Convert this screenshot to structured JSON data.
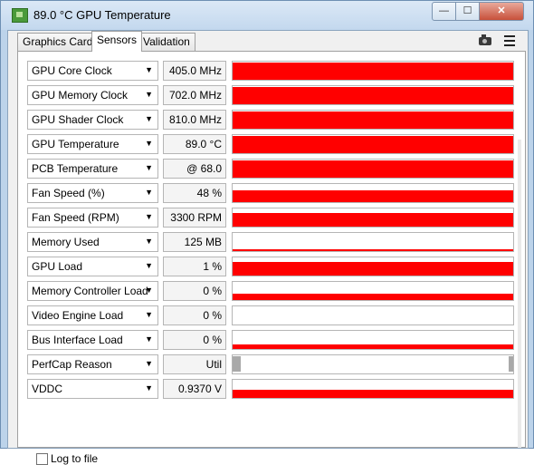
{
  "window": {
    "title": "89.0 °C GPU Temperature",
    "buttons": {
      "minimize": "—",
      "maximize": "☐",
      "close": "✕"
    }
  },
  "tabs": [
    {
      "label": "Graphics Card"
    },
    {
      "label": "Sensors",
      "active": true
    },
    {
      "label": "Validation"
    }
  ],
  "toolbar": {
    "screenshot_icon": "camera-icon",
    "menu_icon": "hamburger-menu-icon"
  },
  "sensors": [
    {
      "name": "GPU Core Clock",
      "value": "405.0 MHz",
      "graph_fill": 0.95
    },
    {
      "name": "GPU Memory Clock",
      "value": "702.0 MHz",
      "graph_fill": 0.95
    },
    {
      "name": "GPU Shader Clock",
      "value": "810.0 MHz",
      "graph_fill": 0.95
    },
    {
      "name": "GPU Temperature",
      "value": "89.0 °C",
      "graph_fill": 0.95
    },
    {
      "name": "PCB Temperature",
      "value": "@ 68.0",
      "graph_fill": 0.95
    },
    {
      "name": "Fan Speed (%)",
      "value": "48 %",
      "graph_fill": 0.65
    },
    {
      "name": "Fan Speed (RPM)",
      "value": "3300 RPM",
      "graph_fill": 0.75
    },
    {
      "name": "Memory Used",
      "value": "125 MB",
      "graph_fill": 0.1
    },
    {
      "name": "GPU Load",
      "value": "1 %",
      "graph_fill": 0.75
    },
    {
      "name": "Memory Controller Load",
      "value": "0 %",
      "graph_fill": 0.35
    },
    {
      "name": "Video Engine Load",
      "value": "0 %",
      "graph_fill": 0
    },
    {
      "name": "Bus Interface Load",
      "value": "0 %",
      "graph_fill": 0.25
    },
    {
      "name": "PerfCap Reason",
      "value": "Util",
      "graph_fill": 0
    },
    {
      "name": "VDDC",
      "value": "0.9370 V",
      "graph_fill": 0.45
    }
  ],
  "footer": {
    "log_label": "Log to file",
    "log_checked": false
  },
  "colors": {
    "graph": "#ff0000",
    "perfcap": "#a9a9a9"
  }
}
